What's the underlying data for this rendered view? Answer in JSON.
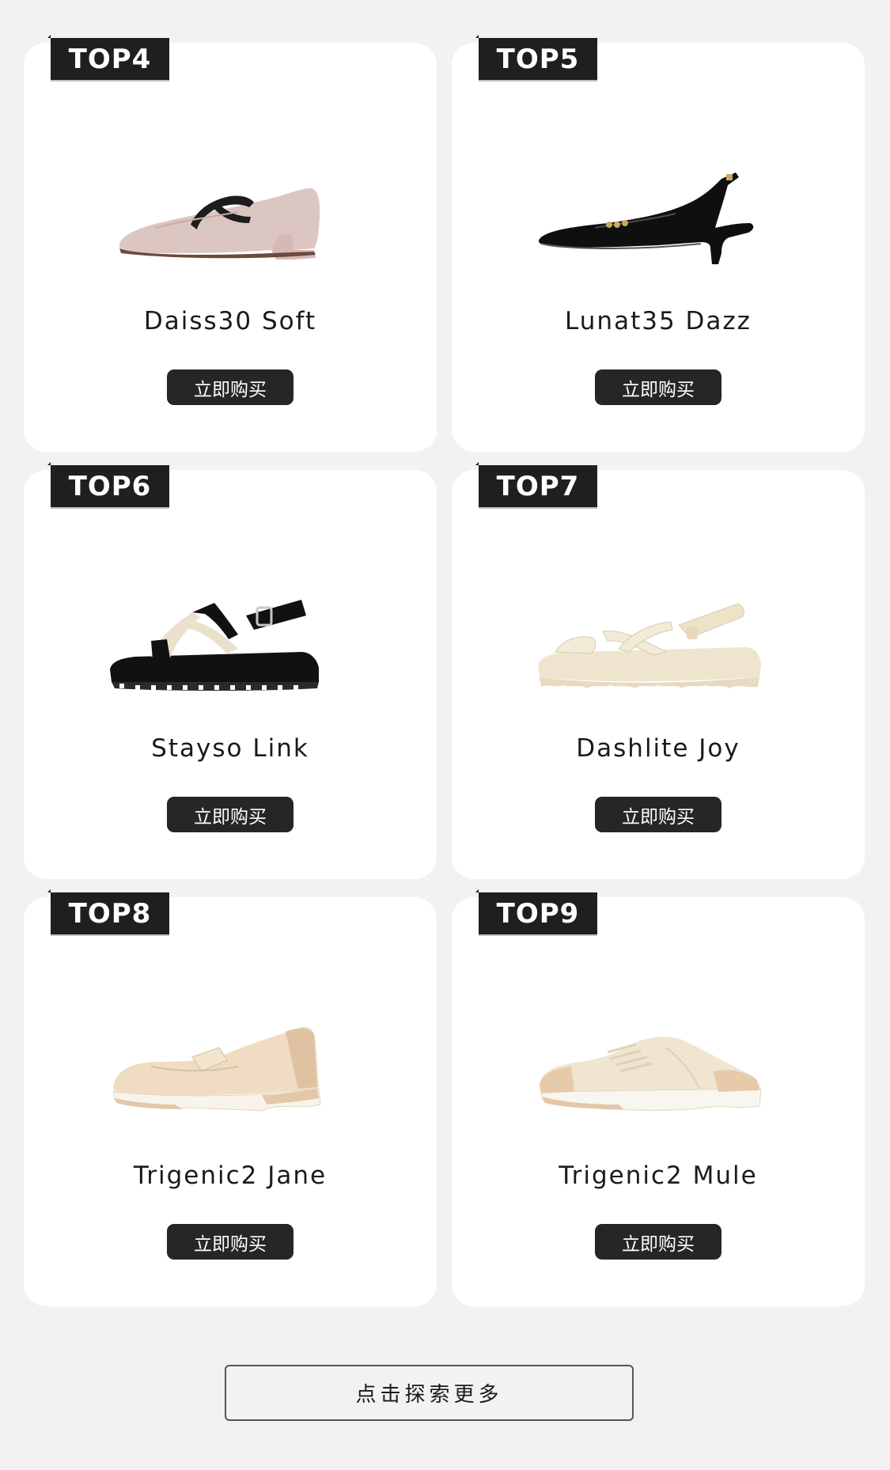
{
  "products": [
    {
      "rank": "TOP4",
      "name": "Daiss30 Soft",
      "buy_label": "立即购买",
      "image_icon": "pink-mary-jane-pump-image"
    },
    {
      "rank": "TOP5",
      "name": "Lunat35 Dazz",
      "buy_label": "立即购买",
      "image_icon": "black-patent-slingback-heel-image"
    },
    {
      "rank": "TOP6",
      "name": "Stayso Link",
      "buy_label": "立即购买",
      "image_icon": "black-cream-platform-sandal-image"
    },
    {
      "rank": "TOP7",
      "name": "Dashlite Joy",
      "buy_label": "立即购买",
      "image_icon": "cream-strappy-sport-sandal-image"
    },
    {
      "rank": "TOP8",
      "name": "Trigenic2 Jane",
      "buy_label": "立即购买",
      "image_icon": "beige-mary-jane-sneaker-image"
    },
    {
      "rank": "TOP9",
      "name": "Trigenic2 Mule",
      "buy_label": "立即购买",
      "image_icon": "beige-lace-up-mule-sneaker-image"
    }
  ],
  "explore_more_label": "点击探索更多",
  "colors": {
    "background": "#f2f2f2",
    "card": "#ffffff",
    "badge": "#1f1f1f",
    "button": "#262626"
  }
}
